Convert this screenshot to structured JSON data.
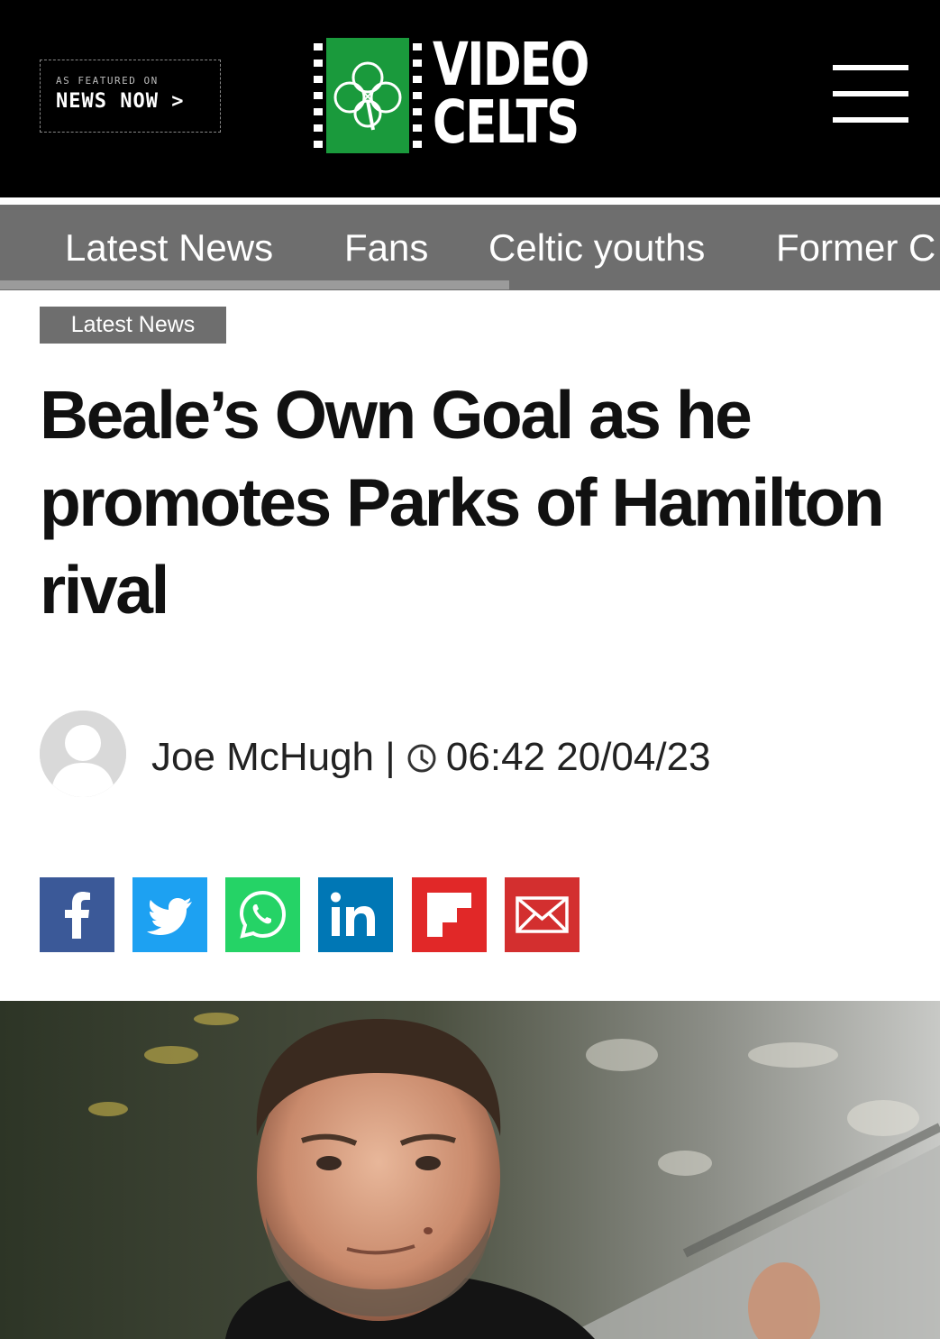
{
  "header": {
    "badge_small": "AS FEATURED ON",
    "badge_big": "NEWS NOW >",
    "logo_line1": "VIDEO",
    "logo_line2": "CELTS",
    "menu_icon": "hamburger-menu-icon"
  },
  "nav": {
    "items": [
      "Latest News",
      "Fans",
      "Celtic youths",
      "Former C"
    ]
  },
  "article": {
    "category": "Latest News",
    "headline": "Beale’s Own Goal as he promotes Parks of Hamilton rival",
    "author": "Joe McHugh",
    "separator": "|",
    "timestamp": "06:42 20/04/23"
  },
  "share": {
    "buttons": [
      {
        "icon": "facebook-icon",
        "color": "#3b5998"
      },
      {
        "icon": "twitter-icon",
        "color": "#1da1f2"
      },
      {
        "icon": "whatsapp-icon",
        "color": "#25d366"
      },
      {
        "icon": "linkedin-icon",
        "color": "#0077b5"
      },
      {
        "icon": "flipboard-icon",
        "color": "#e12828"
      },
      {
        "icon": "email-icon",
        "color": "#d32f2f"
      }
    ]
  },
  "colors": {
    "header_bg": "#000000",
    "nav_bg": "#6e6e6e",
    "logo_green": "#1a9a3c"
  }
}
